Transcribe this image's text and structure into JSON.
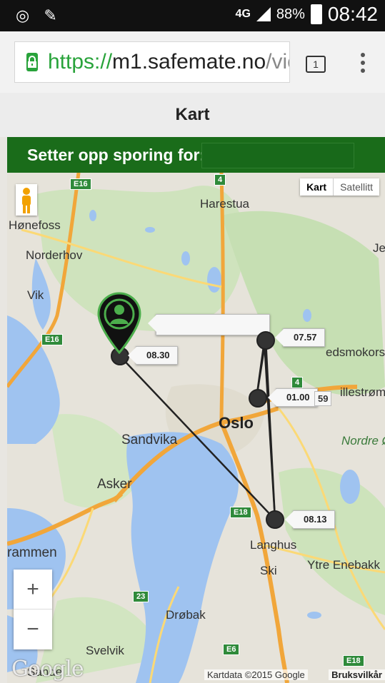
{
  "status": {
    "network": "4G",
    "battery": "88%",
    "time": "08:42"
  },
  "browser": {
    "url_protocol": "https://",
    "url_host": "m1.safemate.no",
    "url_path": "/vie",
    "tab_count": "1"
  },
  "page": {
    "title": "Kart",
    "setup_label": "Setter opp sporing for:"
  },
  "map": {
    "type_active": "Kart",
    "type_inactive": "Satellitt",
    "zoom_in": "+",
    "zoom_out": "−",
    "attribution": "Kartdata ©2015 Google",
    "terms": "Bruksvilkår",
    "logo": "Google",
    "places": {
      "honefoss": "Hønefoss",
      "norderhov": "Norderhov",
      "vik": "Vik",
      "harestua": "Harestua",
      "sandvika": "Sandvika",
      "oslo": "Oslo",
      "asker": "Asker",
      "langhus": "Langhus",
      "ski": "Ski",
      "drammen": "rammen",
      "drobak": "Drøbak",
      "svelvik": "Svelvik",
      "sande": "Sande",
      "ytre_enebakk": "Ytre Enebakk",
      "nordre": "Nordre Ø",
      "lillestrom": "illestrøm",
      "skedsmokorset": "edsmokorset",
      "jen": "en",
      "je": "Je"
    },
    "roads": {
      "e16_top": "E16",
      "e16_left": "E16",
      "r4_top": "4",
      "r4_mid": "4",
      "e18_mid": "E18",
      "e18_bot": "E18",
      "r23": "23",
      "e6": "E6"
    },
    "tracking_points": [
      {
        "id": "p1",
        "time": "08.30"
      },
      {
        "id": "p2",
        "time": "07.57"
      },
      {
        "id": "p3",
        "time": "01.00"
      },
      {
        "id": "p4",
        "time": "08.13"
      }
    ],
    "extra_label": "59"
  }
}
